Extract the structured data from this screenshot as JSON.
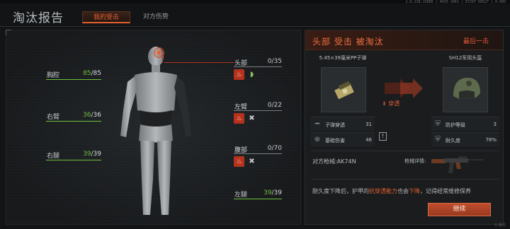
{
  "version_text": "1.0.130.15806 | 0425 2061 | 87207 60527 | 0.000",
  "header": {
    "title": "淘汰报告",
    "tabs": [
      {
        "label": "我的受击",
        "active": true
      },
      {
        "label": "对方伤势",
        "active": false
      }
    ]
  },
  "body_status": {
    "left_limbs": [
      {
        "name": "胸腔",
        "current": "85",
        "max": "/85",
        "ratio": 1.0
      },
      {
        "name": "右臂",
        "current": "36",
        "max": "/36",
        "ratio": 1.0
      },
      {
        "name": "右腿",
        "current": "39",
        "max": "/39",
        "ratio": 1.0
      }
    ],
    "right_parts": [
      {
        "name": "头部",
        "value": "0/35",
        "icons": [
          "bleeding-icon",
          "ear-icon"
        ]
      },
      {
        "name": "左臂",
        "value": "0/22",
        "icons": [
          "bleeding-icon",
          "fracture-icon"
        ]
      },
      {
        "name": "腹部",
        "value": "0/70",
        "icons": [
          "bleeding-icon",
          "fracture-icon"
        ]
      }
    ],
    "left_leg": {
      "name": "左腿",
      "current": "39",
      "max": "/39"
    }
  },
  "death_info": {
    "title": "头部 受击 被淘汰",
    "killer_label": "最后一击",
    "ammo": {
      "name": "5.45×39毫米PP子弹",
      "stats": [
        {
          "label": "子弹穿透",
          "value": "31",
          "icon": "bullet-icon"
        },
        {
          "label": "基础伤害",
          "value": "46",
          "icon": "crosshair-icon"
        }
      ]
    },
    "armor": {
      "name": "SH12军用头盔",
      "stats": [
        {
          "label": "防护等级",
          "value": "3",
          "icon": "armor-class-icon"
        },
        {
          "label": "耐久度",
          "value": "78%",
          "icon": "durability-icon"
        }
      ]
    },
    "penetrate_label": "穿透",
    "warning_mark": "!",
    "weapon_label": "对方枪械:AK74N",
    "weapon_detail_label": "枪械详情:",
    "tip_parts": [
      {
        "text": "耐久度下降后，护甲的",
        "hl": false
      },
      {
        "text": "抗穿透能力",
        "hl": true
      },
      {
        "text": "也会",
        "hl": false
      },
      {
        "text": "下降",
        "hl": true
      },
      {
        "text": "，记得经常维修保养",
        "hl": false
      }
    ],
    "continue_label": "继续"
  },
  "watermark": "© 腾讯"
}
